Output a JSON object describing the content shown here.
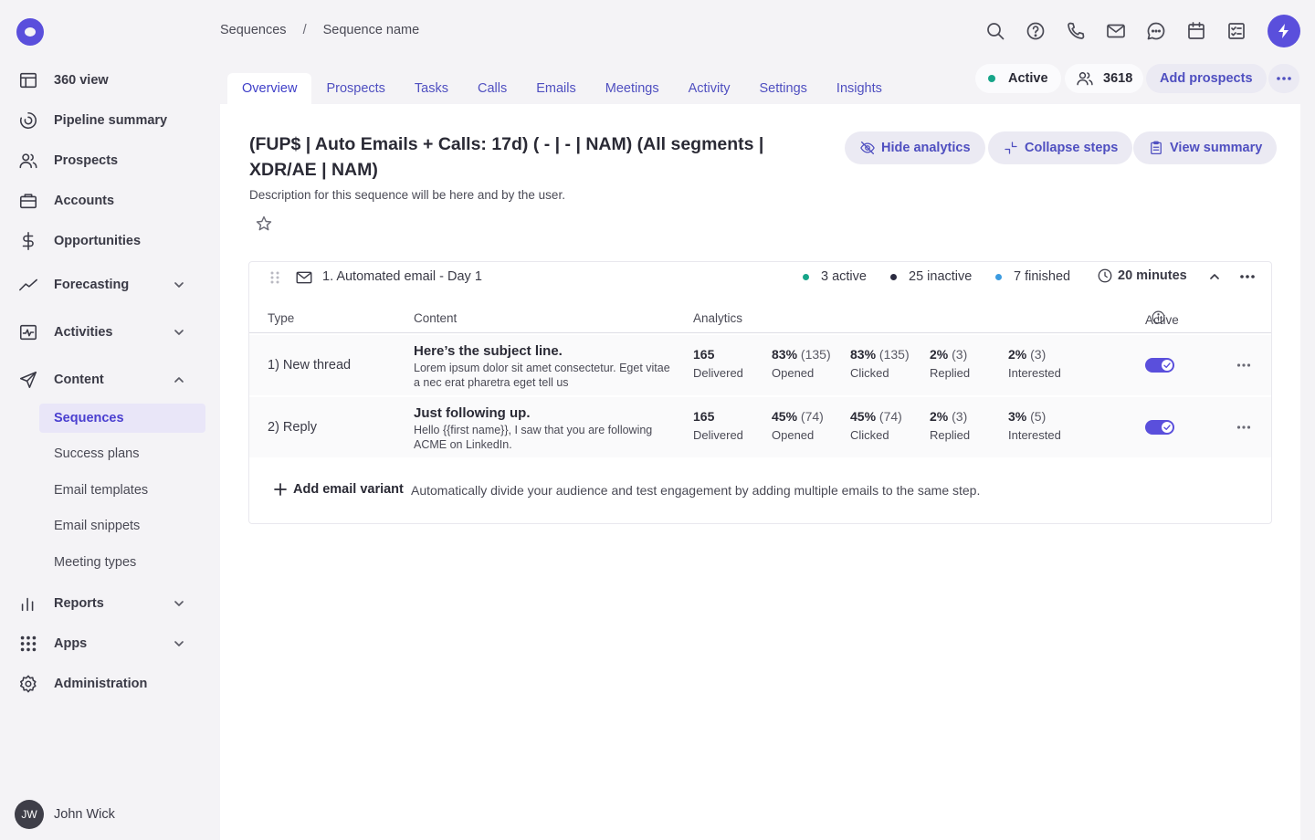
{
  "sidebar": {
    "items": [
      {
        "label": "360 view",
        "icon": "layout-icon"
      },
      {
        "label": "Pipeline summary",
        "icon": "pipeline-icon"
      },
      {
        "label": "Prospects",
        "icon": "users-icon"
      },
      {
        "label": "Accounts",
        "icon": "briefcase-icon"
      },
      {
        "label": "Opportunities",
        "icon": "dollar-icon"
      },
      {
        "label": "Forecasting",
        "icon": "trend-icon"
      },
      {
        "label": "Activities",
        "icon": "activity-icon"
      },
      {
        "label": "Content",
        "icon": "send-icon"
      },
      {
        "label": "Reports",
        "icon": "bar-chart-icon"
      },
      {
        "label": "Apps",
        "icon": "grid-icon"
      },
      {
        "label": "Administration",
        "icon": "gear-icon"
      }
    ],
    "content_sub": [
      "Sequences",
      "Success plans",
      "Email templates",
      "Email snippets",
      "Meeting types"
    ],
    "user": {
      "initials": "JW",
      "name": "John Wick"
    }
  },
  "breadcrumb": {
    "parent": "Sequences",
    "separator": "/",
    "current": "Sequence name"
  },
  "tabs": [
    "Overview",
    "Prospects",
    "Tasks",
    "Calls",
    "Emails",
    "Meetings",
    "Activity",
    "Settings",
    "Insights"
  ],
  "header": {
    "status": "Active",
    "prospect_count": "3618",
    "add_prospects": "Add prospects",
    "status_color": "#17a589",
    "accent": "#5a4fdc"
  },
  "sequence": {
    "title": "(FUP$ | Auto Emails + Calls: 17d) ( - | - | NAM) (All segments | XDR/AE | NAM)",
    "description": "Description for this sequence will be here and by the user.",
    "buttons": {
      "hide_analytics": "Hide analytics",
      "collapse_steps": "Collapse steps",
      "view_summary": "View summary"
    }
  },
  "step": {
    "title": "1. Automated email - Day 1",
    "active": "3 active",
    "inactive": "25 inactive",
    "finished": "7 finished",
    "duration": "20 minutes",
    "columns": {
      "type": "Type",
      "content": "Content",
      "analytics": "Analytics",
      "active": "Active"
    },
    "rows": [
      {
        "type": "1)  New thread",
        "subject": "Here’s the subject line.",
        "snippet": "Lorem ipsum dolor sit amet consectetur. Eget vitae a nec erat pharetra eget tell us",
        "m1": {
          "pct": "165",
          "n": "",
          "label": "Delivered"
        },
        "m2": {
          "pct": "83%",
          "n": "(135)",
          "label": "Opened"
        },
        "m3": {
          "pct": "83%",
          "n": "(135)",
          "label": "Clicked"
        },
        "m4": {
          "pct": "2%",
          "n": "(3)",
          "label": "Replied"
        },
        "m5": {
          "pct": "2%",
          "n": "(3)",
          "label": "Interested"
        },
        "enabled": true
      },
      {
        "type": "2)  Reply",
        "subject": "Just following up.",
        "snippet": "Hello {{first name}}, I saw that you are following ACME on LinkedIn.",
        "m1": {
          "pct": "165",
          "n": "",
          "label": "Delivered"
        },
        "m2": {
          "pct": "45%",
          "n": "(74)",
          "label": "Opened"
        },
        "m3": {
          "pct": "45%",
          "n": "(74)",
          "label": "Clicked"
        },
        "m4": {
          "pct": "2%",
          "n": "(3)",
          "label": "Replied"
        },
        "m5": {
          "pct": "3%",
          "n": "(5)",
          "label": "Interested"
        },
        "enabled": true
      }
    ],
    "add_variant": "Add email variant",
    "add_variant_desc": "Automatically divide your audience and test engagement by adding multiple emails to the same step."
  }
}
